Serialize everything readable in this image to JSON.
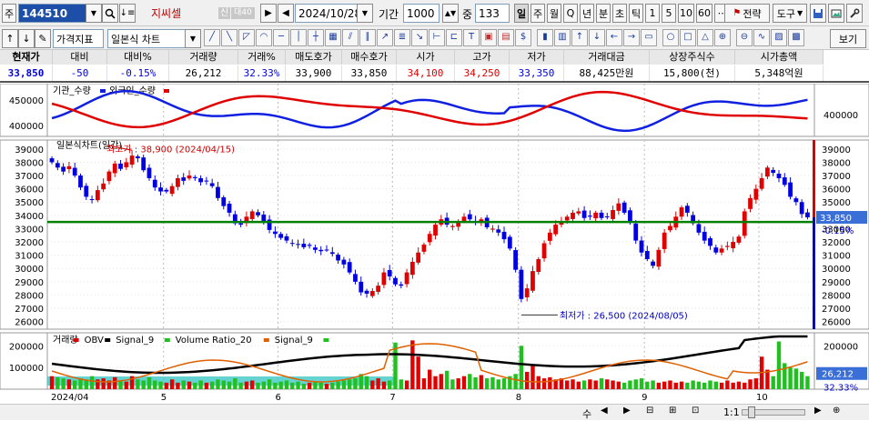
{
  "toolbar1": {
    "market_label": "주",
    "code": "144510",
    "name": "지씨셀",
    "badge_credit": "신",
    "badge_percent": "대40",
    "date": "2024/10/28",
    "period_label": "기간",
    "period_value": "1000",
    "count_label": "중",
    "count_value": "133",
    "periods": [
      "일",
      "주",
      "월",
      "Q",
      "년",
      "분",
      "초",
      "틱",
      "1",
      "5",
      "10",
      "60"
    ],
    "strategy_label": "전략",
    "tools_label": "도구"
  },
  "toolbar2": {
    "indicator_select": "가격지표",
    "chart_type_select": "일본식 차트",
    "view_label": "보기"
  },
  "quote": {
    "headers": [
      "현재가",
      "대비",
      "대비%",
      "거래량",
      "거래%",
      "매도호가",
      "매수호가",
      "시가",
      "고가",
      "저가",
      "거래대금",
      "상장주식수",
      "시가총액"
    ],
    "values": [
      "33,850",
      "-50",
      "-0.15%",
      "26,212",
      "32.33%",
      "33,900",
      "33,850",
      "34,100",
      "34,250",
      "33,350",
      "88,425만원",
      "15,800(천)",
      "5,348억원"
    ],
    "value_colors": [
      "down",
      "down",
      "down",
      "",
      "down",
      "",
      "",
      "up",
      "up",
      "down",
      "",
      "",
      ""
    ]
  },
  "colors": {
    "up": "#e00000",
    "down": "#0000e0",
    "support_line": "#008000",
    "obv": "#000000",
    "volume_ratio": "#e06000",
    "ratio_fill": "#40c8c8"
  },
  "chart_data": [
    {
      "type": "line",
      "legend": [
        "기관_수량",
        "외국인_수량"
      ],
      "yticks": [
        450000,
        400000
      ],
      "right_ticks": [
        400000
      ]
    },
    {
      "type": "candlestick",
      "title": "일본식차트(일간)",
      "max_label": "최고가 : 38,900 (2024/04/15)",
      "min_label": "최저가 : 26,500 (2024/08/05)",
      "yticks": [
        39000,
        38000,
        37000,
        36000,
        35000,
        34000,
        33000,
        32000,
        31000,
        30000,
        29000,
        28000,
        27000,
        26000
      ],
      "ylim": [
        25700,
        39400
      ],
      "current_label": "33,850",
      "current_change": "-0.15%",
      "support_level": 33500,
      "closes": [
        38000,
        37600,
        37300,
        37700,
        37000,
        36100,
        35400,
        35200,
        35900,
        36400,
        37300,
        37900,
        37500,
        38000,
        38500,
        38300,
        37400,
        36800,
        36100,
        35800,
        35800,
        36200,
        36800,
        36600,
        37000,
        36800,
        36500,
        36600,
        36200,
        35300,
        34700,
        34200,
        33400,
        33300,
        33900,
        34300,
        34000,
        33500,
        32900,
        32600,
        32300,
        32100,
        31900,
        31800,
        31600,
        31700,
        31400,
        31300,
        31400,
        31100,
        30600,
        30300,
        29700,
        29000,
        28200,
        28100,
        28300,
        28700,
        29700,
        29400,
        28800,
        28700,
        29700,
        30500,
        31200,
        31800,
        32600,
        33300,
        33700,
        33300,
        33200,
        33500,
        33900,
        33700,
        33500,
        33700,
        33100,
        33000,
        32700,
        32200,
        31500,
        29900,
        27700,
        28500,
        29800,
        30700,
        31900,
        32700,
        33300,
        33500,
        33900,
        34200,
        34300,
        33800,
        33900,
        34200,
        33800,
        33900,
        34400,
        34900,
        34200,
        33500,
        32100,
        31200,
        30700,
        30200,
        31400,
        32700,
        33200,
        33900,
        34600,
        34200,
        33400,
        32700,
        32100,
        31700,
        31200,
        31500,
        31700,
        32000,
        32400,
        34300,
        35300,
        36000,
        36800,
        37600,
        37200,
        36800,
        36300,
        35400,
        35000,
        34100,
        33850
      ]
    },
    {
      "type": "bar",
      "legend": [
        "거래량",
        "OBV",
        "Signal_9",
        "Volume Ratio_20",
        "Signal_9"
      ],
      "yticks": [
        200000,
        100000
      ],
      "right_ticks": [
        200000
      ],
      "current_label": "26,212",
      "current_change": "32.33%",
      "xlabels": [
        "2024/04",
        "5",
        "6",
        "7",
        "8",
        "9",
        "10"
      ],
      "volumes": [
        60000,
        55000,
        50000,
        45000,
        40000,
        50000,
        45000,
        60000,
        45000,
        50000,
        40000,
        55000,
        40000,
        35000,
        60000,
        45000,
        40000,
        55000,
        40000,
        35000,
        30000,
        45000,
        30000,
        40000,
        35000,
        30000,
        40000,
        30000,
        35000,
        45000,
        40000,
        35000,
        50000,
        30000,
        35000,
        40000,
        30000,
        35000,
        45000,
        30000,
        35000,
        40000,
        30000,
        35000,
        25000,
        30000,
        35000,
        30000,
        25000,
        30000,
        35000,
        40000,
        45000,
        50000,
        70000,
        60000,
        40000,
        50000,
        35000,
        40000,
        215000,
        45000,
        40000,
        225000,
        150000,
        50000,
        90000,
        60000,
        70000,
        85000,
        45000,
        50000,
        60000,
        70000,
        55000,
        65000,
        50000,
        55000,
        45000,
        50000,
        60000,
        70000,
        200000,
        80000,
        110000,
        60000,
        50000,
        55000,
        45000,
        50000,
        40000,
        45000,
        35000,
        40000,
        45000,
        40000,
        50000,
        45000,
        40000,
        35000,
        30000,
        40000,
        45000,
        50000,
        35000,
        40000,
        30000,
        35000,
        40000,
        30000,
        35000,
        30000,
        40000,
        35000,
        30000,
        40000,
        35000,
        30000,
        40000,
        30000,
        35000,
        30000,
        45000,
        50000,
        150000,
        90000,
        60000,
        220000,
        120000,
        100000,
        95000,
        80000,
        60000
      ]
    }
  ],
  "bottombar": {
    "zoom_label": "1:1",
    "scroll_label": "수"
  }
}
